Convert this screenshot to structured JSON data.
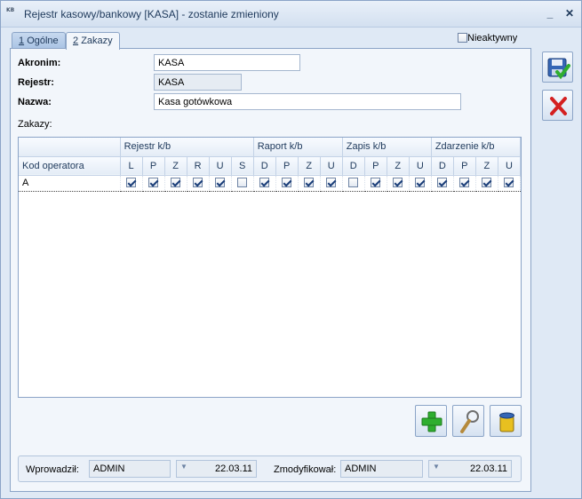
{
  "window": {
    "icon_text": "KB",
    "title": "Rejestr kasowy/bankowy [KASA] - zostanie zmieniony",
    "minimize_symbol": "_",
    "close_symbol": "✕"
  },
  "tabs": [
    {
      "number": "1",
      "label": "Ogólne",
      "active": false
    },
    {
      "number": "2",
      "label": "Zakazy",
      "active": true
    }
  ],
  "inactive_checkbox": {
    "label": "Nieaktywny",
    "checked": false
  },
  "form": {
    "akronim_label": "Akronim:",
    "akronim_value": "KASA",
    "rejestr_label": "Rejestr:",
    "rejestr_value": "KASA",
    "nazwa_label": "Nazwa:",
    "nazwa_value": "Kasa gotówkowa",
    "zakazy_label": "Zakazy:"
  },
  "grid": {
    "groups": [
      "Rejestr k/b",
      "Raport k/b",
      "Zapis k/b",
      "Zdarzenie k/b"
    ],
    "operator_header": "Kod operatora",
    "columns": [
      "L",
      "P",
      "Z",
      "R",
      "U",
      "S",
      "D",
      "P",
      "Z",
      "U",
      "D",
      "P",
      "Z",
      "U",
      "D",
      "P",
      "Z",
      "U"
    ],
    "rows": [
      {
        "kod": "A",
        "checks": [
          true,
          true,
          true,
          true,
          true,
          false,
          true,
          true,
          true,
          true,
          false,
          true,
          true,
          true,
          true,
          true,
          true,
          true
        ]
      }
    ]
  },
  "footer": {
    "wprowadzil_label": "Wprowadził:",
    "wprowadzil_user": "ADMIN",
    "wprowadzil_date": "22.03.11",
    "zmodyfikowal_label": "Zmodyfikował:",
    "zmodyfikowal_user": "ADMIN",
    "zmodyfikowal_date": "22.03.11"
  },
  "icons": {
    "save": "save-icon",
    "cancel": "cancel-icon",
    "add": "add-icon",
    "preview": "magnifier-icon",
    "delete": "trash-icon"
  },
  "colors": {
    "accent": "#1e395b",
    "add_green": "#2fae2f",
    "cancel_red": "#d42020"
  }
}
